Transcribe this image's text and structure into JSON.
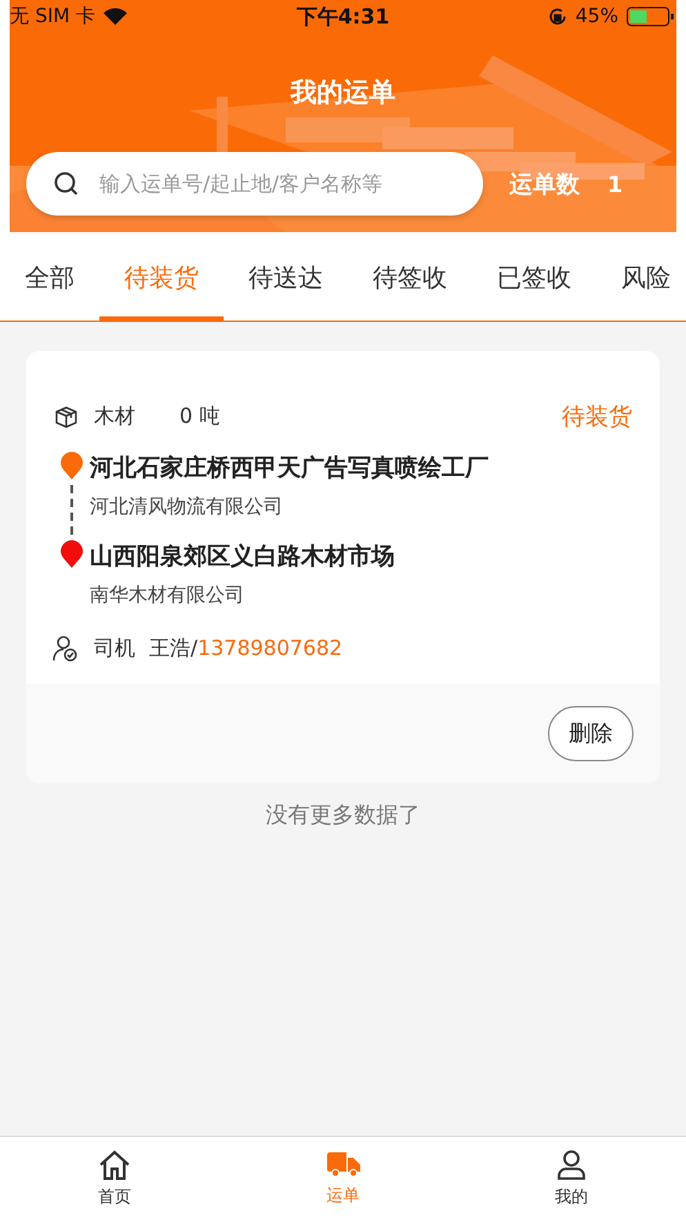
{
  "status_bar": {
    "carrier": "无 SIM 卡",
    "time": "下午4:31",
    "battery": "45%"
  },
  "header": {
    "title": "我的运单",
    "search": {
      "placeholder": "输入运单号/起止地/客户名称等"
    },
    "count_label": "运单数",
    "count": "1"
  },
  "tabs": [
    {
      "label": "全部",
      "selected": false
    },
    {
      "label": "待装货",
      "selected": true
    },
    {
      "label": "待送达",
      "selected": false
    },
    {
      "label": "待签收",
      "selected": false
    },
    {
      "label": "已签收",
      "selected": false
    },
    {
      "label": "风险",
      "selected": false
    }
  ],
  "orders": [
    {
      "cargo": "木材",
      "weight": "0 吨",
      "status": "待装货",
      "stops": [
        {
          "kind": "origin",
          "place": "河北石家庄桥西甲天广告写真喷绘工厂",
          "company": "河北清风物流有限公司"
        },
        {
          "kind": "destination",
          "place": "山西阳泉郊区义白路木材市场",
          "company": "南华木材有限公司"
        }
      ],
      "driver_label": "司机",
      "driver": "王浩/",
      "phone": "13789807682",
      "actions": [
        "删除"
      ]
    }
  ],
  "footer_note": "没有更多数据了",
  "nav": [
    {
      "label": "首页",
      "selected": false
    },
    {
      "label": "运单",
      "selected": true
    },
    {
      "label": "我的",
      "selected": false
    }
  ]
}
